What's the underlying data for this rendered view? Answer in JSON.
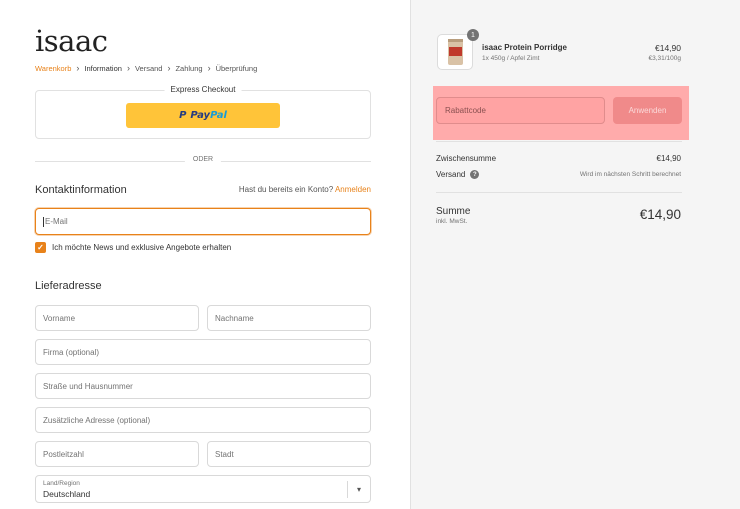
{
  "brand": {
    "logo_text": "isaac",
    "accent_color": "#e8821a"
  },
  "breadcrumb": [
    {
      "label": "Warenkorb",
      "state": "link"
    },
    {
      "label": "Information",
      "state": "active"
    },
    {
      "label": "Versand",
      "state": "upcoming"
    },
    {
      "label": "Zahlung",
      "state": "upcoming"
    },
    {
      "label": "Überprüfung",
      "state": "upcoming"
    }
  ],
  "express": {
    "title": "Express Checkout",
    "paypal_part1": "Pay",
    "paypal_part2": "Pal",
    "paypal_icon": "paypal-p-icon"
  },
  "divider": {
    "label": "ODER"
  },
  "contact": {
    "title": "Kontaktinformation",
    "account_prompt": "Hast du bereits ein Konto?",
    "login_link": "Anmelden",
    "email_placeholder": "E-Mail",
    "newsletter_label": "Ich möchte News und exklusive Angebote erhalten",
    "newsletter_checked": true
  },
  "shipping": {
    "title": "Lieferadresse",
    "first_name_placeholder": "Vorname",
    "last_name_placeholder": "Nachname",
    "company_placeholder": "Firma (optional)",
    "street_placeholder": "Straße und Hausnummer",
    "address2_placeholder": "Zusätzliche Adresse (optional)",
    "zip_placeholder": "Postleitzahl",
    "city_placeholder": "Stadt",
    "country_label": "Land/Region",
    "country_value": "Deutschland"
  },
  "order": {
    "item": {
      "quantity": "1",
      "name": "isaac Protein Porridge",
      "variant": "1x 450g / Apfel Zimt",
      "price": "€14,90",
      "unit_price": "€3,31/100g"
    },
    "discount": {
      "placeholder": "Rabattcode",
      "button_label": "Anwenden"
    },
    "subtotal_label": "Zwischensumme",
    "subtotal_value": "€14,90",
    "shipping_label": "Versand",
    "shipping_note": "Wird im nächsten Schritt berechnet",
    "total_label": "Summe",
    "total_sub": "inkl. MwSt.",
    "total_value": "€14,90"
  }
}
